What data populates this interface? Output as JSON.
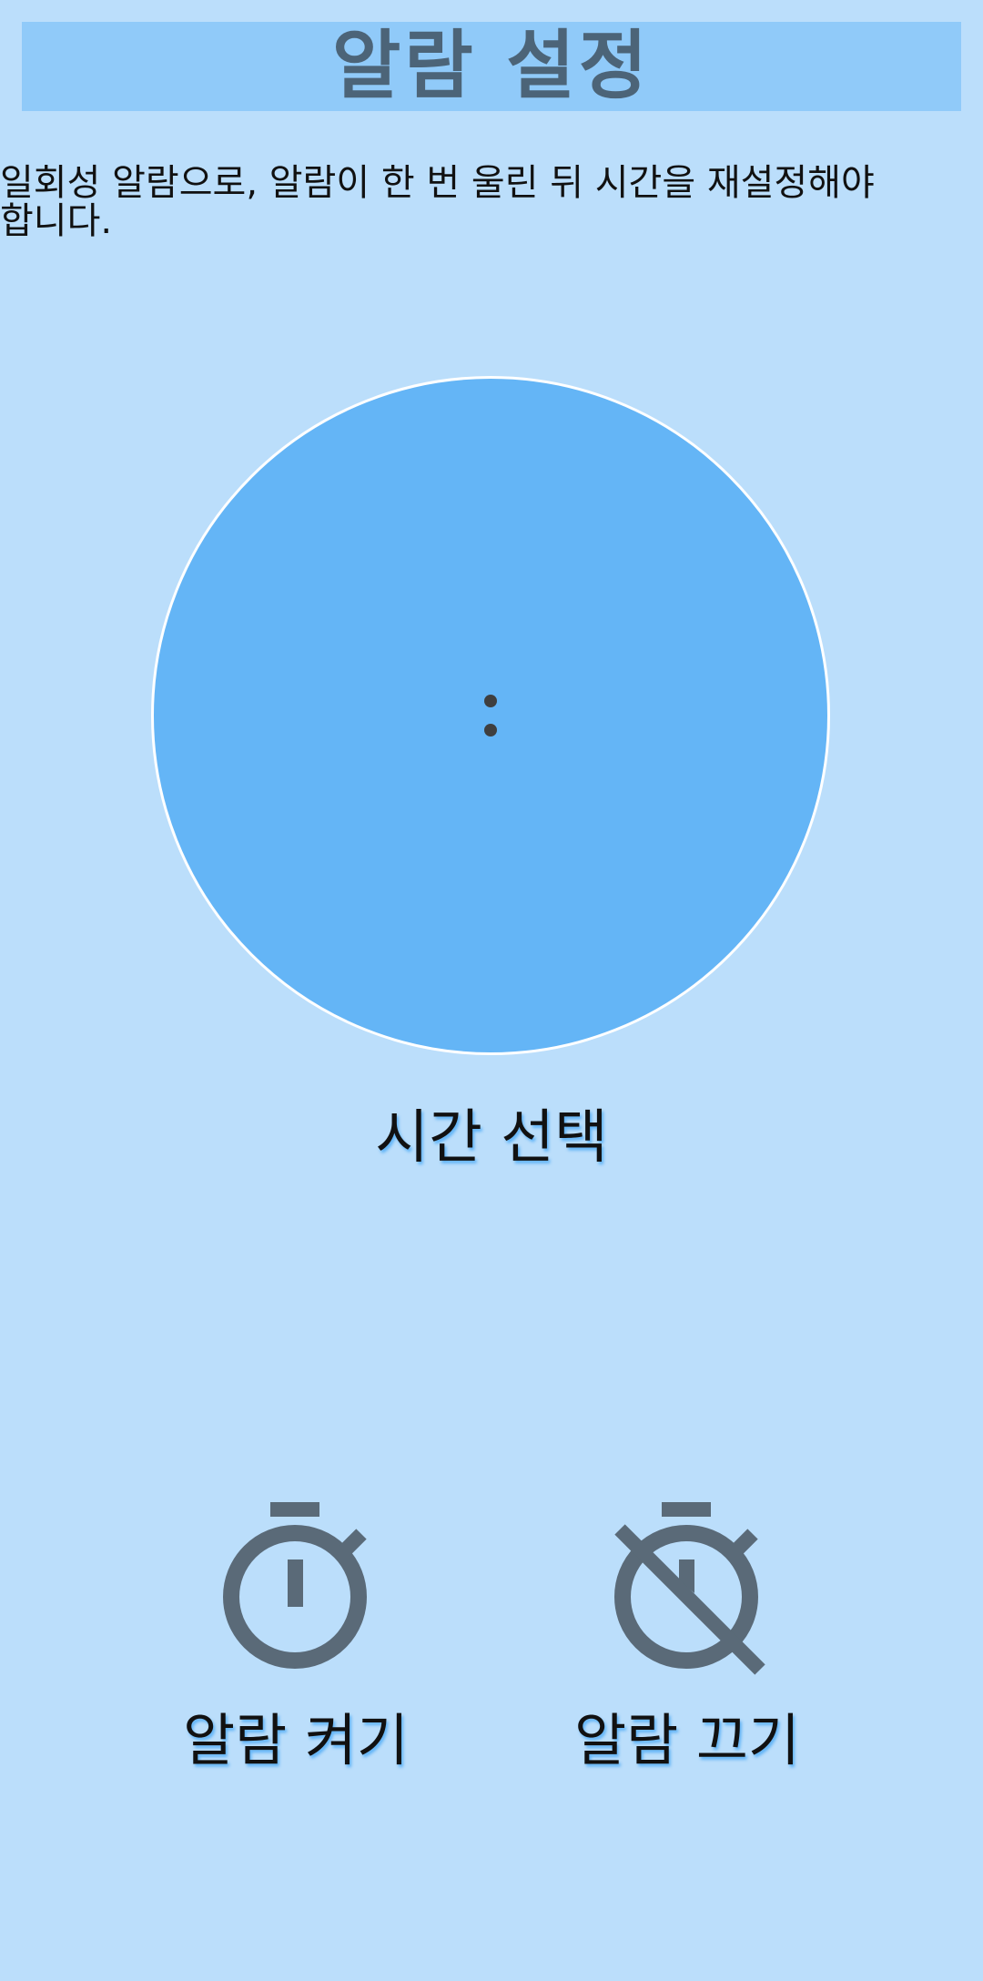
{
  "header": {
    "title": "알람 설정"
  },
  "description": "일회성 알람으로, 알람이 한 번 울린 뒤 시간을 재설정해야 합니다.",
  "dial": {
    "separator": ":"
  },
  "select_time_label": "시간 선택",
  "actions": {
    "on": {
      "label": "알람 켜기",
      "icon": "stopwatch-icon"
    },
    "off": {
      "label": "알람 끄기",
      "icon": "stopwatch-off-icon"
    }
  },
  "colors": {
    "background": "#bbdefb",
    "header": "#90caf9",
    "dial": "#64b5f6",
    "title_text": "#4c6478",
    "icon": "#5a6a78"
  }
}
